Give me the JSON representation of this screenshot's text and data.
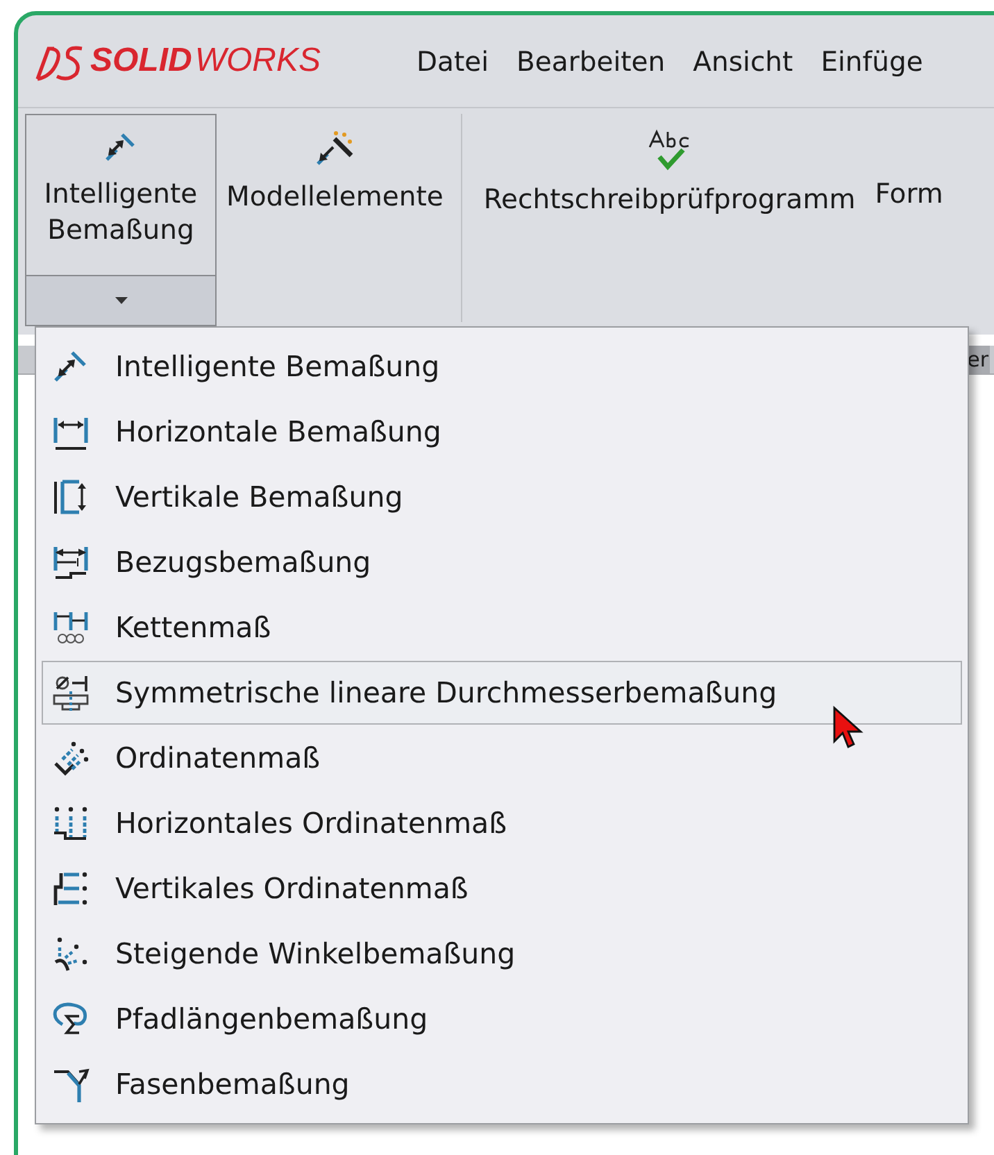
{
  "logo": {
    "bold": "SOLID",
    "light": "WORKS"
  },
  "menu_bar": [
    "Datei",
    "Bearbeiten",
    "Ansicht",
    "Einfüge"
  ],
  "toolbar": [
    {
      "label": "Intelligente Bemaßung",
      "selected": true,
      "has_dropdown": true
    },
    {
      "label": "Modellelemente",
      "selected": false,
      "has_dropdown": false
    },
    {
      "label": "Rechtschreibprüfprogramm",
      "selected": false,
      "has_dropdown": false
    },
    {
      "label": "Form",
      "selected": false,
      "has_dropdown": false
    }
  ],
  "tab_strip": {
    "label": "er"
  },
  "dropdown_menu": [
    {
      "label": "Intelligente Bemaßung",
      "selected": false
    },
    {
      "label": "Horizontale Bemaßung",
      "selected": false
    },
    {
      "label": "Vertikale Bemaßung",
      "selected": false
    },
    {
      "label": "Bezugsbemaßung",
      "selected": false
    },
    {
      "label": "Kettenmaß",
      "selected": false
    },
    {
      "label": "Symmetrische lineare Durchmesserbemaßung",
      "selected": true
    },
    {
      "label": "Ordinatenmaß",
      "selected": false
    },
    {
      "label": "Horizontales Ordinatenmaß",
      "selected": false
    },
    {
      "label": "Vertikales Ordinatenmaß",
      "selected": false
    },
    {
      "label": "Steigende Winkelbemaßung",
      "selected": false
    },
    {
      "label": "Pfadlängenbemaßung",
      "selected": false
    },
    {
      "label": "Fasenbemaßung",
      "selected": false
    }
  ]
}
